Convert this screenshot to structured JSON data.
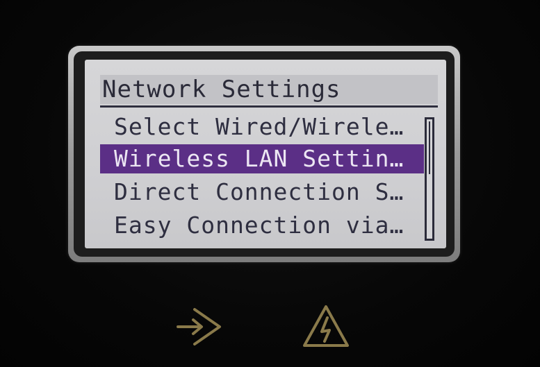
{
  "screen": {
    "title": "Network Settings",
    "menu_items": [
      {
        "label": "Select Wired/Wirele…",
        "selected": false
      },
      {
        "label": "Wireless LAN Settin…",
        "selected": true
      },
      {
        "label": "Direct Connection S…",
        "selected": false
      },
      {
        "label": "Easy Connection via…",
        "selected": false
      }
    ]
  },
  "buttons": {
    "left_icon": "login-arrow-icon",
    "right_icon": "warning-power-icon"
  },
  "colors": {
    "lcd_background": "#cfcfd2",
    "selection": "#5b2f86",
    "text": "#2e2e40",
    "icon": "#8a7a4a"
  }
}
